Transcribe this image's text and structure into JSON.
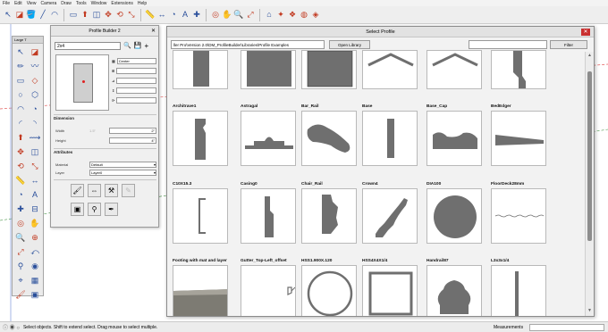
{
  "menu": [
    "File",
    "Edit",
    "View",
    "Camera",
    "Draw",
    "Tools",
    "Window",
    "Extensions",
    "Help"
  ],
  "toolbar_icons": [
    "select-icon",
    "eraser-icon",
    "paint-bucket-icon",
    "line-icon",
    "arc-icon",
    "shapes-icon",
    "pushpull-icon",
    "offset-icon",
    "move-icon",
    "rotate-icon",
    "scale-icon",
    "tape-icon",
    "dimension-icon",
    "protractor-icon",
    "text-icon",
    "axes-icon",
    "orbit-icon",
    "pan-icon",
    "zoom-icon",
    "zoom-extents-icon",
    "warehouse-icon",
    "extension-icon",
    "components-icon",
    "materials-icon",
    "styles-icon"
  ],
  "large_tool_set": {
    "title": "Large T",
    "icons": [
      "select-icon",
      "eraser-icon",
      "pencil-icon",
      "freehand-icon",
      "rectangle-icon",
      "rotated-rect-icon",
      "circle-icon",
      "polygon-icon",
      "arc-icon",
      "pie-icon",
      "arc-3pt-icon",
      "arc-2pt-icon",
      "pushpull-icon",
      "followme-icon",
      "move-icon",
      "offset-icon",
      "rotate-icon",
      "scale-icon",
      "tape-icon",
      "dimension-icon",
      "protractor-icon",
      "text-icon",
      "axes-icon",
      "section-icon",
      "orbit-icon",
      "pan-icon",
      "zoom-icon",
      "zoomwindow-icon",
      "zoom-extents-icon",
      "previous-view-icon",
      "walk-icon",
      "lookaround-icon",
      "position-camera-icon",
      "sandbox-icon",
      "paint-icon",
      "component-icon"
    ]
  },
  "profile_builder": {
    "title": "Profile Builder 2",
    "name_value": "2x4",
    "align_label": "Center",
    "sections": {
      "dimension": "Dimension",
      "attributes": "Attributes"
    },
    "width": {
      "label": "Width",
      "hint": "1.5\"",
      "value": "2\""
    },
    "height": {
      "label": "Height",
      "value": "4\""
    },
    "material": {
      "label": "Material",
      "value": "Default"
    },
    "layer": {
      "label": "Layer",
      "value": "Layer0"
    }
  },
  "select_profile": {
    "title": "Select Profile",
    "path": "ller Pro\\Version 2.0\\DM_ProfileBuilder\\Libraries\\Profile Examples",
    "open_library": "Open Library",
    "filter_button": "Filter",
    "top_row": [
      "top-rect-narrow",
      "top-rect-wide",
      "top-square",
      "top-roof",
      "top-roof2",
      "top-stepped"
    ],
    "items": [
      {
        "name": "Architrave1",
        "shape": "architrave"
      },
      {
        "name": "Astragal",
        "shape": "astragal"
      },
      {
        "name": "Bar_Rail",
        "shape": "bar-rail"
      },
      {
        "name": "Base",
        "shape": "base"
      },
      {
        "name": "Base_Cap",
        "shape": "base-cap"
      },
      {
        "name": "BedEdger",
        "shape": "bed-edger"
      },
      {
        "name": "C10X15.3",
        "shape": "channel"
      },
      {
        "name": "Casing0",
        "shape": "casing"
      },
      {
        "name": "Chair_Rail",
        "shape": "chair-rail"
      },
      {
        "name": "Crown4",
        "shape": "crown"
      },
      {
        "name": "DIA100",
        "shape": "circle"
      },
      {
        "name": "FloorDeck28mm",
        "shape": "floor-deck"
      },
      {
        "name": "Footing with mat and layer",
        "shape": "footing"
      },
      {
        "name": "Gutter_Top-Left_offset",
        "shape": "gutter"
      },
      {
        "name": "HSS1.900X.120",
        "shape": "pipe"
      },
      {
        "name": "HSS4X4X1/4",
        "shape": "square-tube"
      },
      {
        "name": "Handrail87",
        "shape": "handrail"
      },
      {
        "name": "L3x3x1/4",
        "shape": "angle"
      }
    ]
  },
  "status": {
    "text": "Select objects. Shift to extend select. Drag mouse to select multiple.",
    "measurements_label": "Measurements"
  },
  "colors": {
    "profile_fill": "#6f6f6f",
    "title_bar": "#e2e2e2",
    "close_red": "#c93030"
  }
}
